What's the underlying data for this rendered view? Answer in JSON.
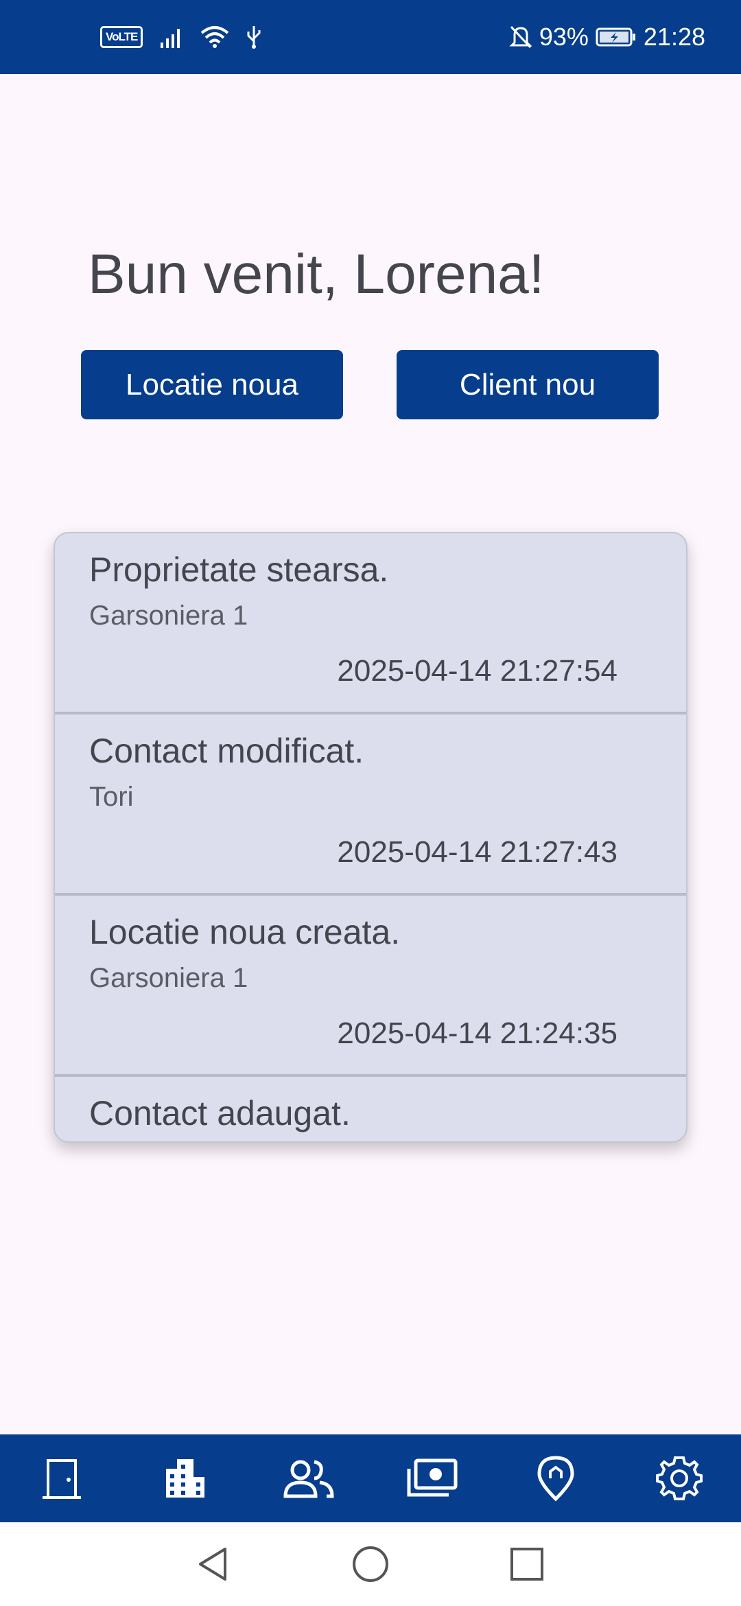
{
  "status_bar": {
    "volte_label": "VoLTE",
    "battery_percent": "93%",
    "time": "21:28",
    "icons": [
      "volte-icon",
      "signal-icon",
      "wifi-icon",
      "usb-icon",
      "mute-icon",
      "battery-charging-icon"
    ]
  },
  "greeting": "Bun venit, Lorena!",
  "actions": {
    "new_location": "Locatie noua",
    "new_client": "Client nou"
  },
  "activity": [
    {
      "title": "Proprietate stearsa.",
      "subject": "Garsoniera 1",
      "time": "2025-04-14 21:27:54"
    },
    {
      "title": "Contact modificat.",
      "subject": "Tori",
      "time": "2025-04-14 21:27:43"
    },
    {
      "title": "Locatie noua creata.",
      "subject": "Garsoniera 1",
      "time": "2025-04-14 21:24:35"
    },
    {
      "title": "Contact adaugat.",
      "subject": "",
      "time": ""
    }
  ],
  "bottom_nav": [
    "door-icon",
    "building-icon",
    "people-icon",
    "money-icon",
    "location-icon",
    "gear-icon"
  ],
  "colors": {
    "primary": "#063d8c",
    "background": "#fdf7fd",
    "card": "#dcdeee",
    "text": "#44454d"
  }
}
